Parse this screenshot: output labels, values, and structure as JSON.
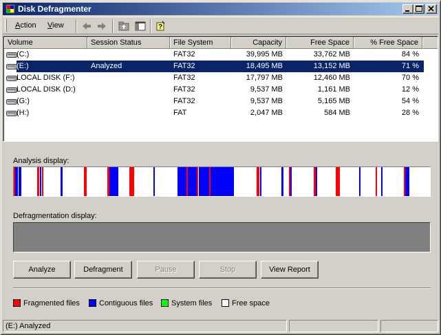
{
  "window": {
    "title": "Disk Defragmenter",
    "icon": "defrag-app-icon",
    "controls": [
      "minimize-icon",
      "maximize-icon",
      "close-icon"
    ]
  },
  "menu": {
    "action": "Action",
    "view": "View"
  },
  "toolbar": {
    "icons": [
      "back-arrow-icon",
      "forward-arrow-icon",
      "folder-up-icon",
      "show-pane-icon",
      "help-icon"
    ]
  },
  "volume_list": {
    "columns": [
      "Volume",
      "Session Status",
      "File System",
      "Capacity",
      "Free Space",
      "% Free Space"
    ],
    "rows": [
      {
        "volume": "(C:)",
        "status": "",
        "fs": "FAT32",
        "capacity": "39,995 MB",
        "free": "33,762 MB",
        "pct": "84 %",
        "selected": false
      },
      {
        "volume": "(E:)",
        "status": "Analyzed",
        "fs": "FAT32",
        "capacity": "18,495 MB",
        "free": "13,152 MB",
        "pct": "71 %",
        "selected": true
      },
      {
        "volume": "LOCAL DISK (F:)",
        "status": "",
        "fs": "FAT32",
        "capacity": "17,797 MB",
        "free": "12,460 MB",
        "pct": "70 %",
        "selected": false
      },
      {
        "volume": "LOCAL DISK (D:)",
        "status": "",
        "fs": "FAT32",
        "capacity": "9,537 MB",
        "free": "1,161 MB",
        "pct": "12 %",
        "selected": false
      },
      {
        "volume": "(G:)",
        "status": "",
        "fs": "FAT32",
        "capacity": "9,537 MB",
        "free": "5,165 MB",
        "pct": "54 %",
        "selected": false
      },
      {
        "volume": "(H:)",
        "status": "",
        "fs": "FAT",
        "capacity": "2,047 MB",
        "free": "584 MB",
        "pct": "28 %",
        "selected": false
      }
    ]
  },
  "analysis": {
    "label": "Analysis display:",
    "segments": [
      {
        "start": 0.0,
        "end": 0.004,
        "type": "fragmented"
      },
      {
        "start": 0.004,
        "end": 0.01,
        "type": "contiguous"
      },
      {
        "start": 0.012,
        "end": 0.018,
        "type": "contiguous"
      },
      {
        "start": 0.057,
        "end": 0.062,
        "type": "fragmented"
      },
      {
        "start": 0.062,
        "end": 0.066,
        "type": "contiguous"
      },
      {
        "start": 0.068,
        "end": 0.072,
        "type": "fragmented"
      },
      {
        "start": 0.112,
        "end": 0.117,
        "type": "contiguous"
      },
      {
        "start": 0.168,
        "end": 0.174,
        "type": "fragmented"
      },
      {
        "start": 0.224,
        "end": 0.23,
        "type": "fragmented"
      },
      {
        "start": 0.23,
        "end": 0.252,
        "type": "contiguous"
      },
      {
        "start": 0.278,
        "end": 0.29,
        "type": "fragmented"
      },
      {
        "start": 0.335,
        "end": 0.339,
        "type": "contiguous"
      },
      {
        "start": 0.394,
        "end": 0.415,
        "type": "contiguous"
      },
      {
        "start": 0.415,
        "end": 0.419,
        "type": "fragmented"
      },
      {
        "start": 0.419,
        "end": 0.44,
        "type": "contiguous"
      },
      {
        "start": 0.44,
        "end": 0.444,
        "type": "fragmented"
      },
      {
        "start": 0.444,
        "end": 0.469,
        "type": "contiguous"
      },
      {
        "start": 0.469,
        "end": 0.473,
        "type": "fragmented"
      },
      {
        "start": 0.473,
        "end": 0.529,
        "type": "contiguous"
      },
      {
        "start": 0.583,
        "end": 0.589,
        "type": "fragmented"
      },
      {
        "start": 0.591,
        "end": 0.594,
        "type": "contiguous"
      },
      {
        "start": 0.643,
        "end": 0.648,
        "type": "contiguous"
      },
      {
        "start": 0.661,
        "end": 0.665,
        "type": "fragmented"
      },
      {
        "start": 0.665,
        "end": 0.668,
        "type": "contiguous"
      },
      {
        "start": 0.721,
        "end": 0.726,
        "type": "fragmented"
      },
      {
        "start": 0.726,
        "end": 0.73,
        "type": "contiguous"
      },
      {
        "start": 0.773,
        "end": 0.783,
        "type": "fragmented"
      },
      {
        "start": 0.83,
        "end": 0.834,
        "type": "contiguous"
      },
      {
        "start": 0.87,
        "end": 0.872,
        "type": "fragmented"
      },
      {
        "start": 0.882,
        "end": 0.886,
        "type": "contiguous"
      },
      {
        "start": 0.937,
        "end": 0.941,
        "type": "fragmented"
      },
      {
        "start": 0.941,
        "end": 0.951,
        "type": "contiguous"
      }
    ]
  },
  "defrag": {
    "label": "Defragmentation display:"
  },
  "buttons": {
    "analyze": "Analyze",
    "defragment": "Defragment",
    "pause": "Pause",
    "stop": "Stop",
    "view_report": "View Report"
  },
  "legend": {
    "fragmented": "Fragmented files",
    "contiguous": "Contiguous files",
    "system": "System files",
    "free": "Free space"
  },
  "colors": {
    "fragmented": "#ff0000",
    "contiguous": "#0000ff",
    "system": "#00ff00",
    "free": "#ffffff",
    "selection": "#0a246a",
    "title_start": "#0a246a",
    "title_end": "#a6caf0"
  },
  "status": {
    "text": "(E:) Analyzed"
  }
}
